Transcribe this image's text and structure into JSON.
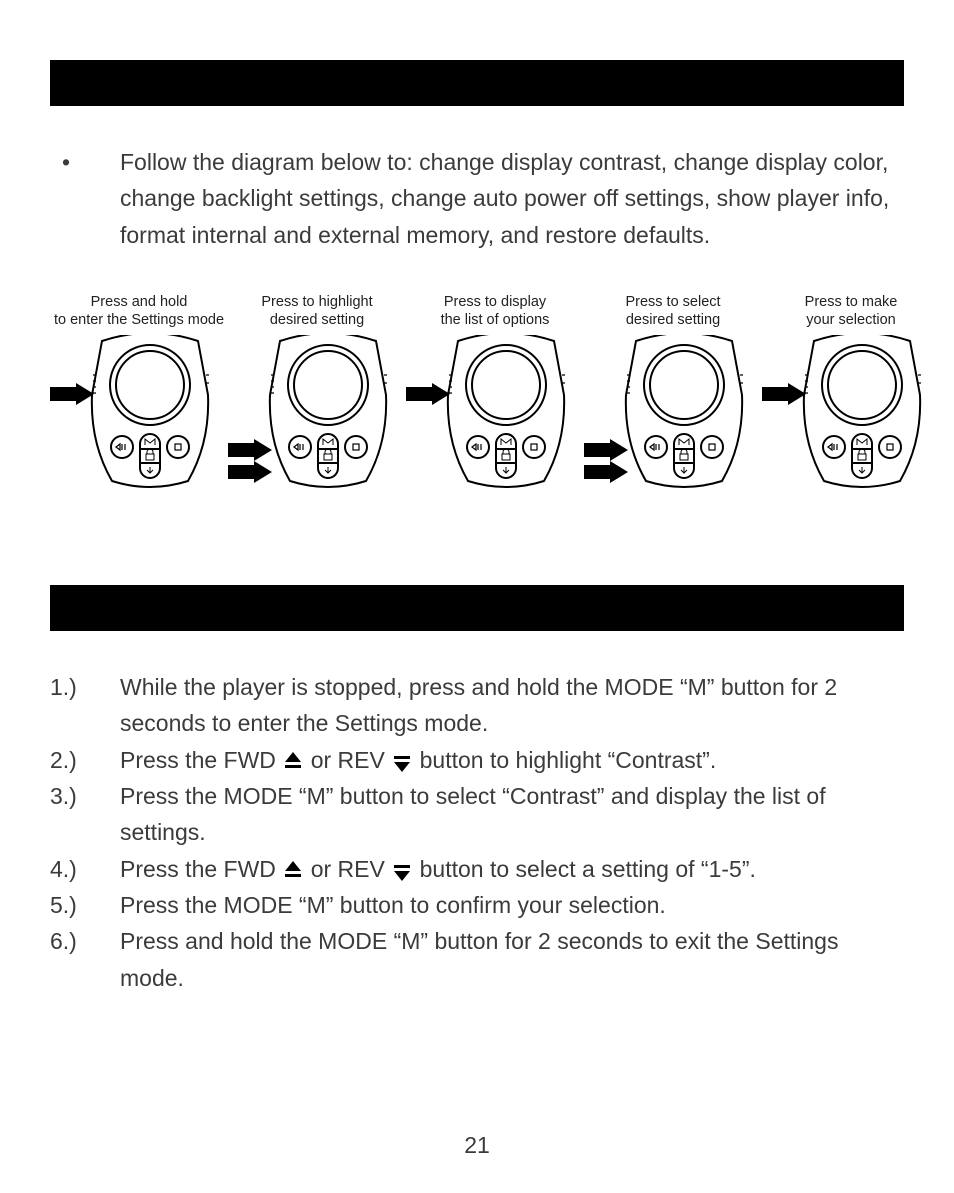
{
  "intro": {
    "bullet": "•",
    "text": "Follow the diagram below to: change display contrast, change display color, change backlight settings, change auto power off settings, show player info, format internal and external memory, and restore defaults."
  },
  "diagram": [
    {
      "line1": "Press and hold",
      "line2": "to enter the Settings mode",
      "arrows": [
        "high"
      ]
    },
    {
      "line1": "Press to highlight",
      "line2": "desired setting",
      "arrows": [
        "mid",
        "low"
      ]
    },
    {
      "line1": "Press to display",
      "line2": "the list of options",
      "arrows": [
        "high"
      ]
    },
    {
      "line1": "Press to select",
      "line2": "desired setting",
      "arrows": [
        "mid",
        "low"
      ]
    },
    {
      "line1": "Press to make",
      "line2": "your selection",
      "arrows": [
        "high"
      ]
    }
  ],
  "steps": [
    {
      "num": "1.)",
      "pre": "While the player is stopped, press and hold the MODE “M” button for 2 seconds to enter the Settings mode."
    },
    {
      "num": "2.)",
      "pre": "Press the FWD ",
      "g1": "up",
      "mid": " or REV ",
      "g2": "down",
      "post": " button to highlight “Contrast”."
    },
    {
      "num": "3.)",
      "pre": "Press the MODE “M” button to select “Contrast” and display the list of settings."
    },
    {
      "num": "4.)",
      "pre": "Press the FWD ",
      "g1": "up",
      "mid": " or REV ",
      "g2": "down",
      "post": " button to select a setting of “1-5”."
    },
    {
      "num": "5.)",
      "pre": "Press the MODE “M” button to confirm your selection."
    },
    {
      "num": "6.)",
      "pre": "Press and hold the MODE “M” button for 2 seconds to exit the Settings mode."
    }
  ],
  "pagenum": "21",
  "icons": {
    "device": "mp3-player-device",
    "arrow": "arrow-right",
    "up": "fwd-up-glyph",
    "down": "rev-down-glyph"
  }
}
